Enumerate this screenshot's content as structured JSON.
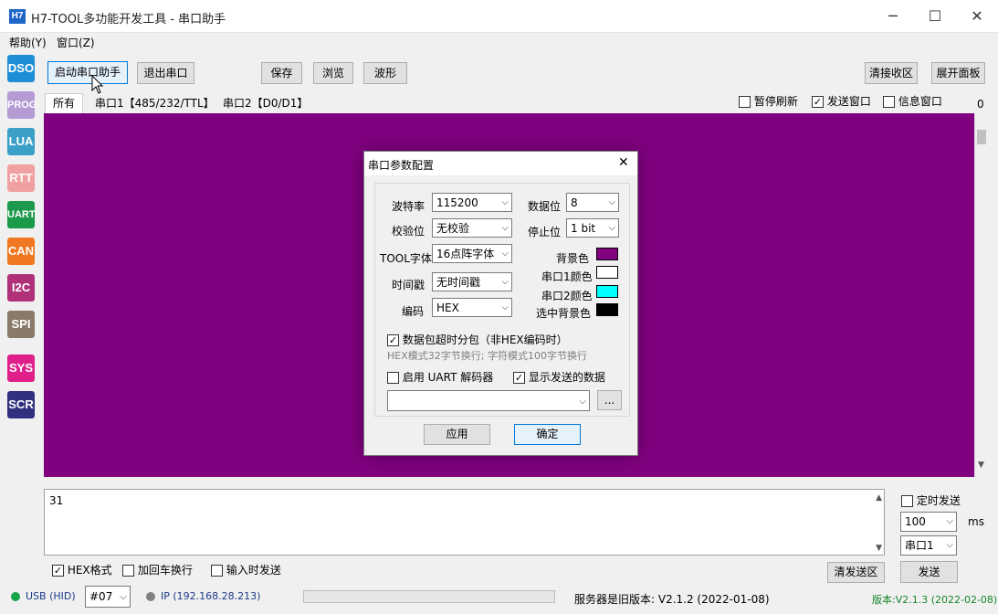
{
  "window": {
    "title": "H7-TOOL多功能开发工具 - 串口助手",
    "icon_label": "H7",
    "minimize": "─",
    "maximize": "☐",
    "close": "✕"
  },
  "menu": [
    "帮助(Y)",
    "窗口(Z)"
  ],
  "sidebar": [
    {
      "label": "DSO",
      "color": "#1e8fd6"
    },
    {
      "label": "PROG",
      "color": "#b59bd4"
    },
    {
      "label": "LUA",
      "color": "#3aa0c8"
    },
    {
      "label": "RTT",
      "color": "#f0a0a0"
    },
    {
      "label": "UART",
      "color": "#1a9a4a"
    },
    {
      "label": "CAN",
      "color": "#f07820"
    },
    {
      "label": "I2C",
      "color": "#b0307a"
    },
    {
      "label": "SPI",
      "color": "#8a7a6a"
    },
    {
      "label": "SYS",
      "color": "#e0208a"
    },
    {
      "label": "SCR",
      "color": "#303080"
    }
  ],
  "toolbar": {
    "start_serial": "启动串口助手",
    "exit_serial": "退出串口",
    "save": "保存",
    "browse": "浏览",
    "waveform": "波形",
    "clear_recv": "清接收区",
    "expand_panel": "展开面板"
  },
  "tabs": [
    "所有",
    "串口1【485/232/TTL】",
    "串口2【D0/D1】"
  ],
  "top_checks": {
    "pause_refresh": "暂停刷新",
    "send_window": "发送窗口",
    "info_window": "信息窗口",
    "counter": "0"
  },
  "dialog": {
    "title": "串口参数配置",
    "close": "✕",
    "baud_label": "波特率",
    "baud_value": "115200",
    "databits_label": "数据位",
    "databits_value": "8",
    "parity_label": "校验位",
    "parity_value": "无校验",
    "stopbits_label": "停止位",
    "stopbits_value": "1 bit",
    "font_label": "TOOL字体",
    "font_value": "16点阵字体",
    "bg_label": "背景色",
    "timestamp_label": "时间戳",
    "timestamp_value": "无时间戳",
    "com1_color_label": "串口1颜色",
    "com2_color_label": "串口2颜色",
    "encoding_label": "编码",
    "encoding_value": "HEX",
    "selected_bg_label": "选中背景色",
    "timeout_split": "数据包超时分包（非HEX编码时）",
    "hint": "HEX模式32字节换行; 字符模式100字节换行",
    "uart_decoder": "启用 UART 解码器",
    "show_sent": "显示发送的数据",
    "dots": "...",
    "apply": "应用",
    "ok": "确定",
    "colors": {
      "bg": "#800080",
      "com1": "#ffffff",
      "com2": "#00ffff",
      "selected": "#000000"
    }
  },
  "send": {
    "text": "31",
    "timed_send": "定时发送",
    "interval": "100",
    "ms": "ms",
    "port": "串口1",
    "hex_format": "HEX格式",
    "add_newline": "加回车换行",
    "send_on_input": "输入时发送",
    "clear_send": "清发送区",
    "send_btn": "发送"
  },
  "status": {
    "usb": "USB (HID)",
    "device": "#07",
    "ip": "IP (192.168.28.213)",
    "server_version": "服务器是旧版本: V2.1.2 (2022-01-08)",
    "version": "版本:V2.1.3 (2022-02-08)"
  }
}
